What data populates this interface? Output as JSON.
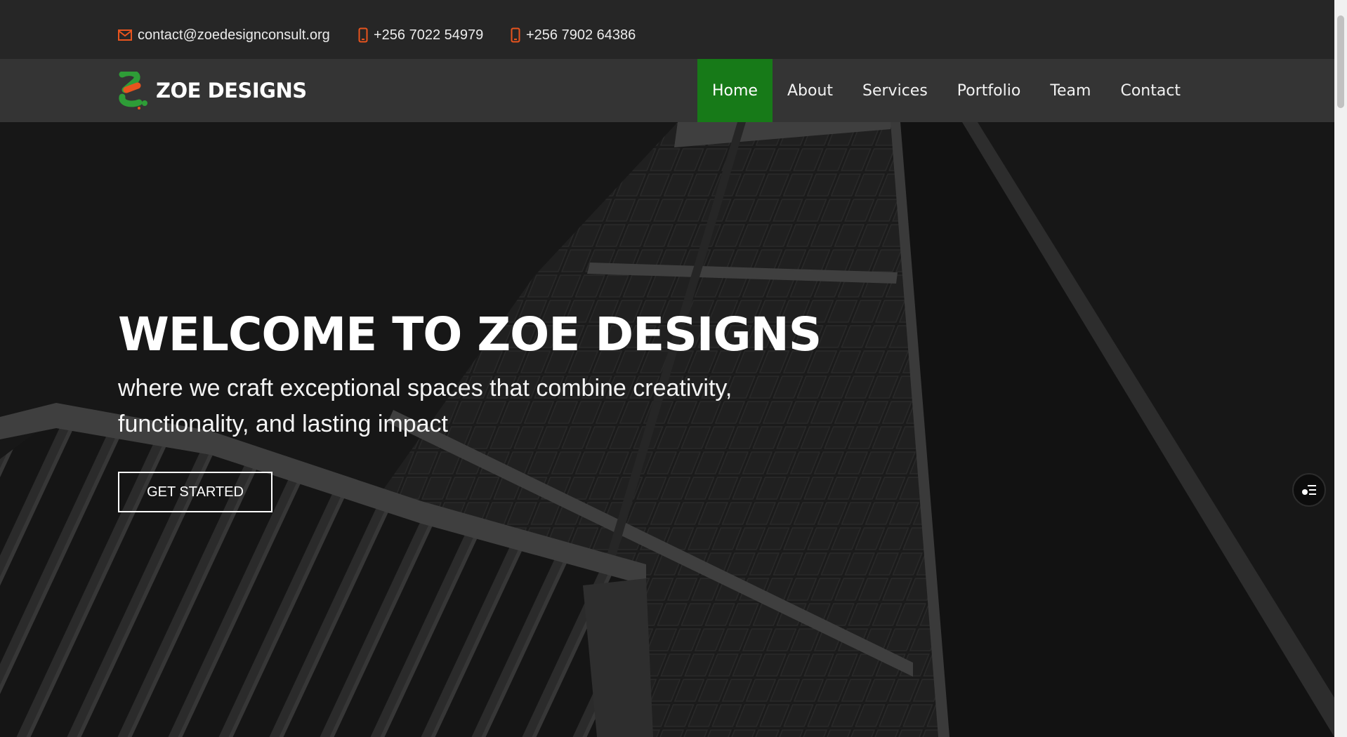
{
  "topbar": {
    "email": "contact@zoedesignconsult.org",
    "phone_1": "+256 7022 54979",
    "phone_2": "+256 7902 64386",
    "email_icon": "envelope-icon",
    "phone_icon": "mobile-phone-icon",
    "icon_color": "#e8541e"
  },
  "header": {
    "logo_text": "ZOE DESIGNS",
    "logo_colors": [
      "#2e9d37",
      "#e8541e"
    ],
    "nav": [
      {
        "label": "Home",
        "active": true
      },
      {
        "label": "About",
        "active": false
      },
      {
        "label": "Services",
        "active": false
      },
      {
        "label": "Portfolio",
        "active": false
      },
      {
        "label": "Team",
        "active": false
      },
      {
        "label": "Contact",
        "active": false
      }
    ],
    "active_color": "#177a18"
  },
  "hero": {
    "title": "WELCOME TO ZOE DESIGNS",
    "subtitle": "where we craft exceptional spaces that combine creativity, functionality, and lasting impact",
    "cta_label": "GET STARTED",
    "background": "grayscale-architecture-photo"
  },
  "floating_button": {
    "icon": "settings-list-icon"
  }
}
